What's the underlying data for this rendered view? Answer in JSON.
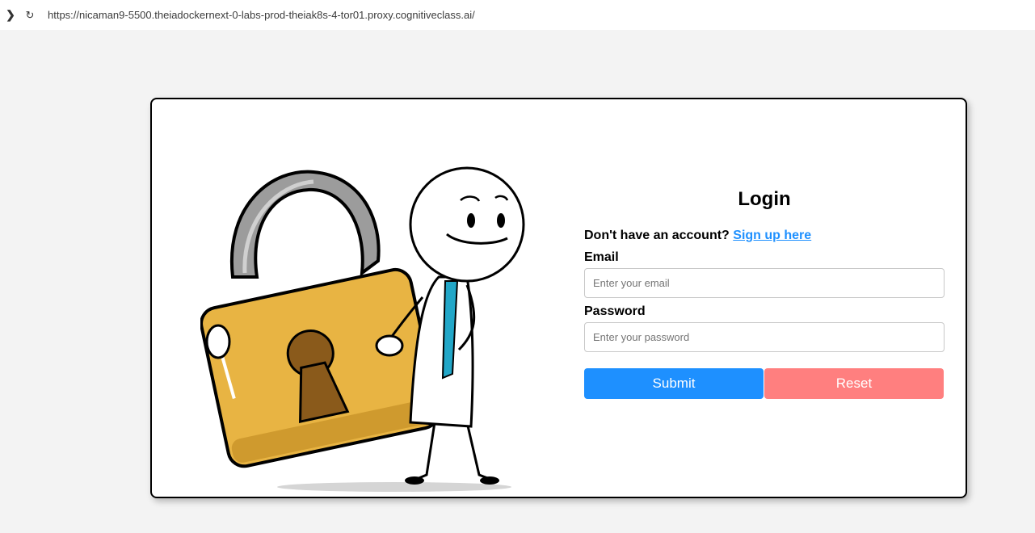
{
  "browser": {
    "url": "https://nicaman9-5500.theiadockernext-0-labs-prod-theiak8s-4-tor01.proxy.cognitiveclass.ai/",
    "icons": [
      "chevron-right-icon",
      "reload-icon"
    ]
  },
  "login": {
    "title": "Login",
    "signup_prompt": "Don't have an account?",
    "signup_link": "Sign up here",
    "email_label": "Email",
    "email_placeholder": "Enter your email",
    "password_label": "Password",
    "password_placeholder": "Enter your password",
    "submit_label": "Submit",
    "reset_label": "Reset"
  },
  "colors": {
    "submit": "#1e90ff",
    "reset": "#ff7f7f",
    "link": "#1e90ff",
    "padlock": "#e8b443"
  }
}
